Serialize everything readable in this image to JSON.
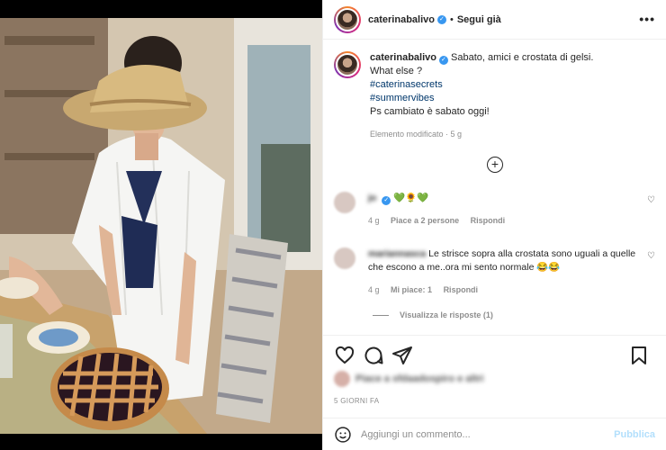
{
  "post": {
    "username": "caterinabalivo",
    "follow_separator": "•",
    "follow_label": "Segui già",
    "more_label": "•••"
  },
  "caption": {
    "username": "caterinabalivo",
    "text": "Sabato, amici e crostata di gelsi.",
    "line2": "What else ?",
    "tags": [
      "#caterinasecrets",
      "#summervibes"
    ],
    "line3": "Ps cambiato è sabato oggi!",
    "meta": "Elemento modificato · 5 g"
  },
  "comments": [
    {
      "username": "jo",
      "text": "💚🌻💚",
      "time": "4 g",
      "likes": "Piace a 2 persone",
      "reply": "Rispondi"
    },
    {
      "username": "mariannasca",
      "text": "Le strisce sopra alla crostata sono uguali a quelle che escono a me..ora mi sento normale 😂😂",
      "time": "4 g",
      "likes": "Mi piace: 1",
      "reply": "Rispondi"
    }
  ],
  "view_replies": "Visualizza le risposte (1)",
  "likes_text": "Piace a sfdaadospiro e altri",
  "date": "5 GIORNI FA",
  "add_comment": {
    "placeholder": "Aggiungi un commento...",
    "publish": "Pubblica"
  },
  "icons": {
    "more": "more-horizontal-icon",
    "add": "plus-circle-icon",
    "like": "heart-icon",
    "comment": "comment-icon",
    "share": "send-icon",
    "save": "bookmark-icon",
    "emoji": "emoji-icon"
  },
  "colors": {
    "link": "#00376b",
    "muted": "#8e8e8e",
    "verified": "#3897f0",
    "publish": "#b2dffc"
  }
}
